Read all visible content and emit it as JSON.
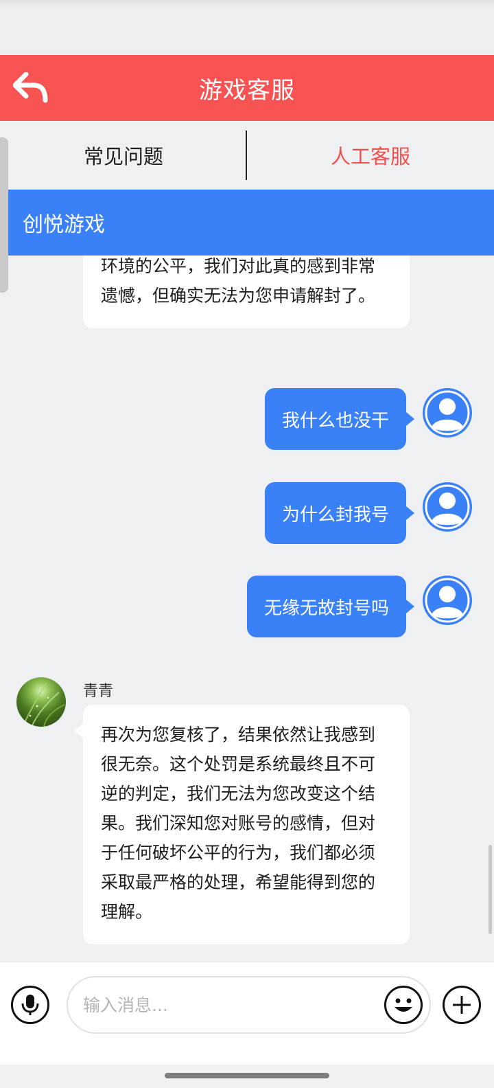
{
  "header": {
    "title": "游戏客服",
    "back_icon": "back-arrow-icon"
  },
  "tabs": [
    {
      "label": "常见问题",
      "active": false
    },
    {
      "label": "人工客服",
      "active": true
    }
  ],
  "company_bar": {
    "name": "创悦游戏"
  },
  "messages": {
    "partial_incoming": "环境的公平，我们对此真的感到非常遗憾，但确实无法为您申请解封了。",
    "outgoing": [
      {
        "text": "我什么也没干"
      },
      {
        "text": "为什么封我号"
      },
      {
        "text": "无缘无故封号吗"
      }
    ],
    "agent": {
      "name": "青青",
      "text": "再次为您复核了，结果依然让我感到很无奈。这个处罚是系统最终且不可逆的判定，我们无法为您改变这个结果。我们深知您对账号的感情，但对于任何破坏公平的行为，我们都必须采取最严格的处理，希望能得到您的理解。"
    }
  },
  "input": {
    "placeholder": "输入消息...",
    "value": ""
  },
  "icons": {
    "mic": "microphone-icon",
    "emoji": "smiley-face-icon",
    "plus": "plus-icon",
    "user_avatar": "user-avatar-icon"
  },
  "colors": {
    "header": "#f65352",
    "accent_blue": "#3a80f7",
    "active_tab": "#f0504f"
  }
}
